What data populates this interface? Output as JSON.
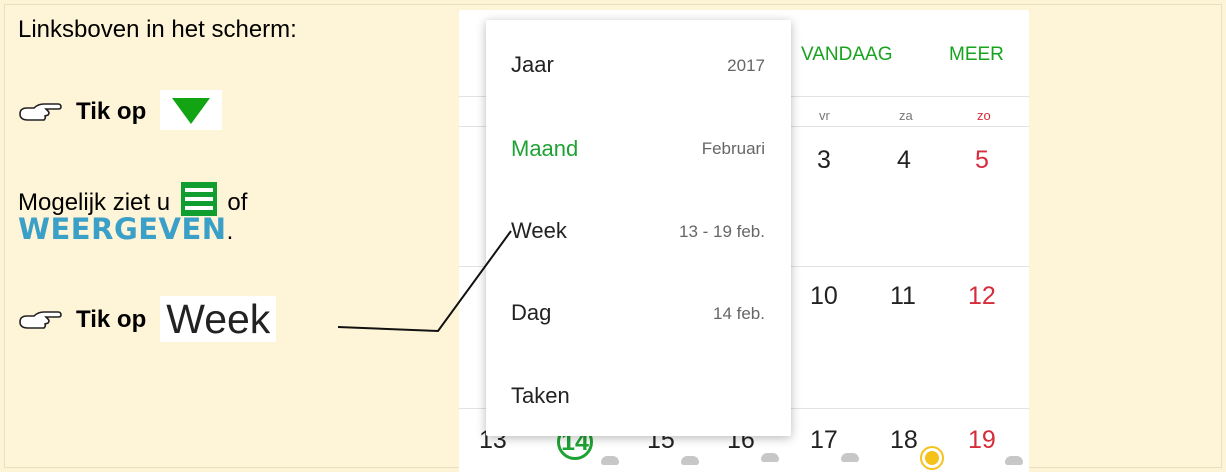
{
  "instructions": {
    "line1": "Linksboven in het scherm:",
    "tik_op_1": "Tik op",
    "line3_a": "Mogelijk ziet u",
    "line3_b": "of",
    "weergeven": "WEERGEVEN",
    "period": ".",
    "tik_op_2": "Tik op",
    "week_word": "Week"
  },
  "toolbar": {
    "vandaag": "VANDAAG",
    "meer": "MEER"
  },
  "calendar": {
    "weekdays": [
      "vr",
      "za",
      "zo"
    ],
    "row1": [
      "3",
      "4",
      "5"
    ],
    "row2": [
      "10",
      "11",
      "12"
    ],
    "row3": [
      "13",
      "14",
      "15",
      "16",
      "17",
      "18",
      "19"
    ]
  },
  "view_menu": {
    "items": [
      {
        "label": "Jaar",
        "value": "2017"
      },
      {
        "label": "Maand",
        "value": "Februari"
      },
      {
        "label": "Week",
        "value": "13 - 19 feb."
      },
      {
        "label": "Dag",
        "value": "14 feb."
      },
      {
        "label": "Taken",
        "value": ""
      }
    ]
  },
  "colors": {
    "accent_green": "#1fa234",
    "sunday_red": "#d62c3b",
    "background": "#fef4d7",
    "weergeven_blue": "#3aa0c8"
  },
  "icons": [
    "pointing-hand-icon",
    "green-triangle-icon",
    "hamburger-menu-icon",
    "cloud-icon",
    "sun-icon"
  ]
}
